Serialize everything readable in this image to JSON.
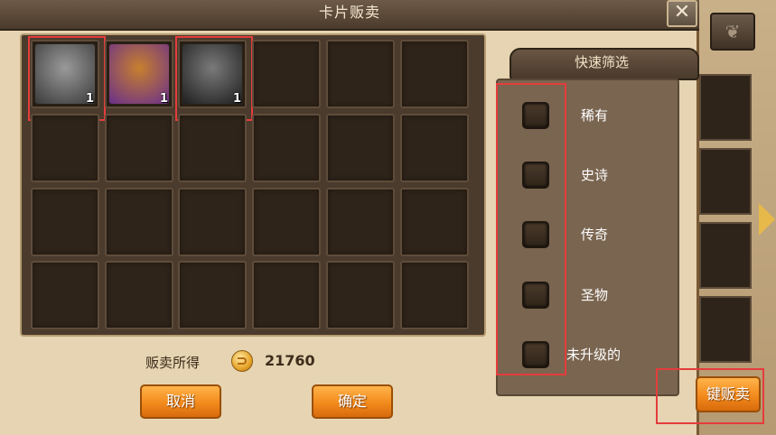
{
  "dialog": {
    "title": "卡片贩卖",
    "close_glyph": "✕"
  },
  "cards": [
    {
      "name": "ram-knight",
      "count": "1",
      "colors": [
        "#9a9a9a",
        "#3a3a3a"
      ],
      "highlighted": true
    },
    {
      "name": "boar-warrior",
      "count": "1",
      "colors": [
        "#c7802e",
        "#6a2f8a"
      ],
      "highlighted": false
    },
    {
      "name": "dark-wolf",
      "count": "1",
      "colors": [
        "#7a7a7a",
        "#1e1e1e"
      ],
      "highlighted": true
    }
  ],
  "proceeds": {
    "label": "贩卖所得",
    "value": "21760",
    "icon": "gold-coin-icon"
  },
  "buttons": {
    "cancel": "取消",
    "confirm": "确定",
    "sell_all": "键贩卖"
  },
  "filter": {
    "title": "快速筛选",
    "options": [
      "稀有",
      "史诗",
      "传奇",
      "圣物",
      "未升级的"
    ]
  },
  "colors": {
    "accent_orange": "#f28a1c",
    "highlight_red": "#e53c3c"
  }
}
